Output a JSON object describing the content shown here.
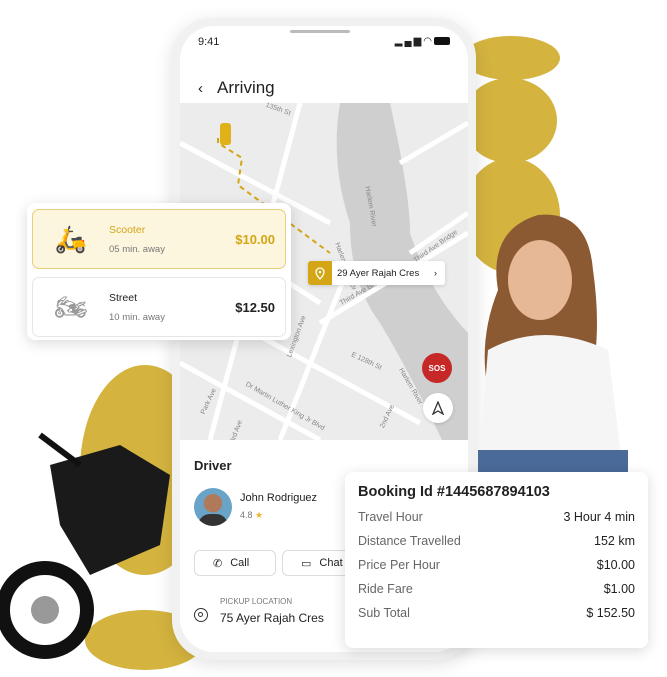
{
  "colors": {
    "accent": "#d4a514",
    "blob": "#d4b43f",
    "sos": "#c62828"
  },
  "status": {
    "time": "9:41",
    "icons": [
      "signal-icon",
      "wifi-icon",
      "battery-icon"
    ]
  },
  "header": {
    "title": "Arriving",
    "back_icon": "chevron-left-icon"
  },
  "map": {
    "labels": [
      "135th St",
      "Harlem River",
      "Third Ave Bridge",
      "Harlem River Dr",
      "Third Ave Br",
      "Lexington Ave",
      "E 128th St",
      "Harlem River",
      "Park Ave",
      "Dr Martin Luther King Jr Blvd",
      "2nd Ave",
      "3rd Ave"
    ],
    "destination": "29 Ayer Rajah Cres",
    "sos": "SOS"
  },
  "vehicles": [
    {
      "name": "Scooter",
      "eta": "05 min. away",
      "price": "$10.00",
      "selected": true
    },
    {
      "name": "Street",
      "eta": "10 min. away",
      "price": "$12.50",
      "selected": false
    }
  ],
  "driver": {
    "heading": "Driver",
    "name": "John Rodriguez",
    "rating": "4.8",
    "call": "Call",
    "chat": "Chat",
    "pickup_label": "PICKUP LOCATION",
    "pickup": "75 Ayer Rajah Cres"
  },
  "booking": {
    "title": "Booking Id #1445687894103",
    "rows": [
      {
        "label": "Travel Hour",
        "value": "3 Hour 4 min"
      },
      {
        "label": "Distance Travelled",
        "value": "152 km"
      },
      {
        "label": "Price Per Hour",
        "value": "$10.00"
      },
      {
        "label": "Ride Fare",
        "value": "$1.00"
      },
      {
        "label": "Sub Total",
        "value": "$ 152.50"
      }
    ]
  }
}
